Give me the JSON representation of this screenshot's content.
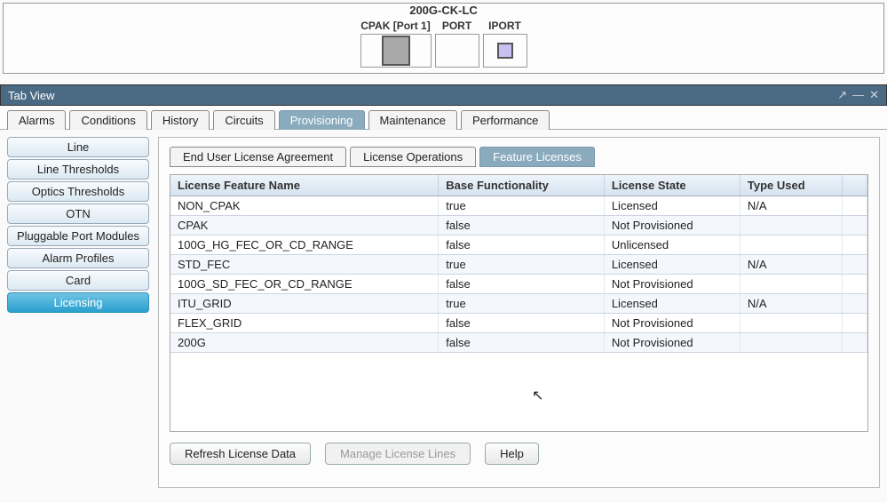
{
  "device": {
    "title": "200G-CK-LC",
    "ports": [
      {
        "label": "CPAK [Port 1]",
        "name": "port-cpak",
        "kind": "gray"
      },
      {
        "label": "PORT",
        "name": "port-port",
        "kind": "none"
      },
      {
        "label": "IPORT",
        "name": "port-iport",
        "kind": "purple"
      }
    ]
  },
  "tab_view_label": "Tab View",
  "main_tabs": [
    {
      "label": "Alarms",
      "name": "alarms",
      "active": false
    },
    {
      "label": "Conditions",
      "name": "conditions",
      "active": false
    },
    {
      "label": "History",
      "name": "history",
      "active": false
    },
    {
      "label": "Circuits",
      "name": "circuits",
      "active": false
    },
    {
      "label": "Provisioning",
      "name": "provisioning",
      "active": true
    },
    {
      "label": "Maintenance",
      "name": "maintenance",
      "active": false
    },
    {
      "label": "Performance",
      "name": "performance",
      "active": false
    }
  ],
  "sidebar": [
    {
      "label": "Line",
      "name": "line",
      "active": false
    },
    {
      "label": "Line Thresholds",
      "name": "line-thresholds",
      "active": false
    },
    {
      "label": "Optics Thresholds",
      "name": "optics-thresholds",
      "active": false
    },
    {
      "label": "OTN",
      "name": "otn",
      "active": false
    },
    {
      "label": "Pluggable Port Modules",
      "name": "pluggable-port-modules",
      "active": false
    },
    {
      "label": "Alarm Profiles",
      "name": "alarm-profiles",
      "active": false
    },
    {
      "label": "Card",
      "name": "card",
      "active": false
    },
    {
      "label": "Licensing",
      "name": "licensing",
      "active": true
    }
  ],
  "sub_tabs": [
    {
      "label": "End User License Agreement",
      "name": "eula",
      "active": false
    },
    {
      "label": "License Operations",
      "name": "license-operations",
      "active": false
    },
    {
      "label": "Feature Licenses",
      "name": "feature-licenses",
      "active": true
    }
  ],
  "table": {
    "columns": [
      "License Feature Name",
      "Base Functionality",
      "License State",
      "Type Used"
    ],
    "rows": [
      {
        "feature": "NON_CPAK",
        "base": "true",
        "state": "Licensed",
        "type": "N/A"
      },
      {
        "feature": "CPAK",
        "base": "false",
        "state": "Not Provisioned",
        "type": ""
      },
      {
        "feature": "100G_HG_FEC_OR_CD_RANGE",
        "base": "false",
        "state": "Unlicensed",
        "type": ""
      },
      {
        "feature": "STD_FEC",
        "base": "true",
        "state": "Licensed",
        "type": "N/A"
      },
      {
        "feature": "100G_SD_FEC_OR_CD_RANGE",
        "base": "false",
        "state": "Not Provisioned",
        "type": ""
      },
      {
        "feature": "ITU_GRID",
        "base": "true",
        "state": "Licensed",
        "type": "N/A"
      },
      {
        "feature": "FLEX_GRID",
        "base": "false",
        "state": "Not Provisioned",
        "type": ""
      },
      {
        "feature": "200G",
        "base": "false",
        "state": "Not Provisioned",
        "type": ""
      }
    ]
  },
  "buttons": {
    "refresh": "Refresh License Data",
    "manage": "Manage License Lines",
    "help": "Help"
  }
}
